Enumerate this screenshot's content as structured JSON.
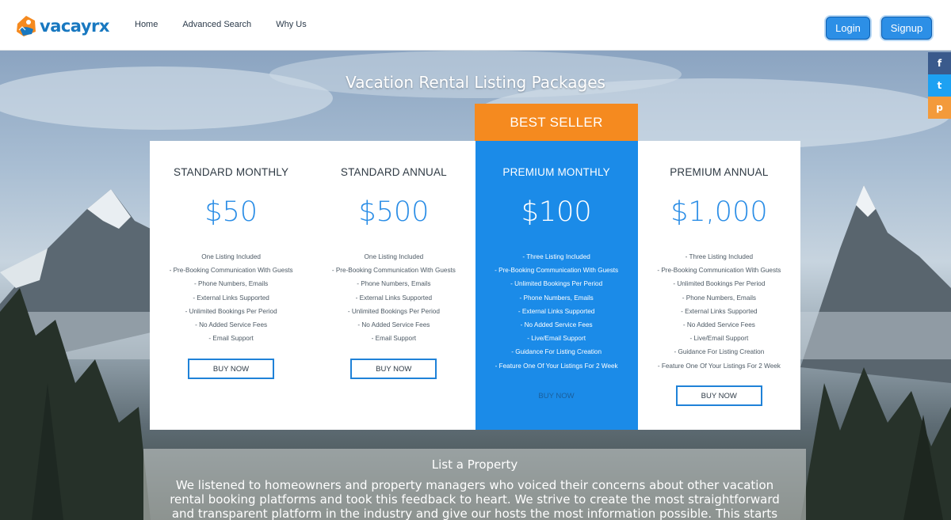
{
  "header": {
    "logo_text": "vacayrx",
    "nav": [
      {
        "label": "Home"
      },
      {
        "label": "Advanced Search"
      },
      {
        "label": "Why Us"
      }
    ],
    "login_label": "Login",
    "signup_label": "Signup"
  },
  "social": {
    "facebook": "f",
    "twitter": "t",
    "pinterest": "p"
  },
  "page_title": "Vacation Rental Listing Packages",
  "badge": "BEST SELLER",
  "plans": [
    {
      "name": "STANDARD MONTHLY",
      "price": "$50",
      "features": [
        "One Listing Included",
        "- Pre-Booking Communication With Guests",
        "- Phone Numbers, Emails",
        "- External Links Supported",
        "- Unlimited Bookings Per Period",
        "- No Added Service Fees",
        "- Email Support"
      ],
      "button": "BUY NOW"
    },
    {
      "name": "STANDARD ANNUAL",
      "price": "$500",
      "features": [
        "One Listing Included",
        "- Pre-Booking Communication With Guests",
        "- Phone Numbers, Emails",
        "- External Links Supported",
        "- Unlimited Bookings Per Period",
        "- No Added Service Fees",
        "- Email Support"
      ],
      "button": "BUY NOW"
    },
    {
      "name": "PREMIUM MONTHLY",
      "price": "$100",
      "features": [
        "- Three Listing Included",
        "- Pre-Booking Communication With Guests",
        "- Unlimited Bookings Per Period",
        "- Phone Numbers, Emails",
        "- External Links Supported",
        "- No Added Service Fees",
        "- Live/Email Support",
        "- Guidance For Listing Creation",
        "- Feature One Of Your Listings For 2 Week"
      ],
      "button": "BUY NOW"
    },
    {
      "name": "PREMIUM ANNUAL",
      "price": "$1,000",
      "features": [
        "- Three Listing Included",
        "- Pre-Booking Communication With Guests",
        "- Unlimited Bookings Per Period",
        "- Phone Numbers, Emails",
        "- External Links Supported",
        "- No Added Service Fees",
        "- Live/Email Support",
        "- Guidance For Listing Creation",
        "- Feature One Of Your Listings For 2 Week"
      ],
      "button": "BUY NOW"
    }
  ],
  "list_property": {
    "title": "List a Property",
    "text": "We listened to homeowners and property managers who voiced their concerns about other vacation rental booking platforms and took this feedback to heart. We strive to create the most straightforward and transparent platform in the industry and give our hosts the most information possible. This starts with"
  },
  "colors": {
    "brand_blue": "#1b8be8",
    "badge_orange": "#f58a1f"
  }
}
